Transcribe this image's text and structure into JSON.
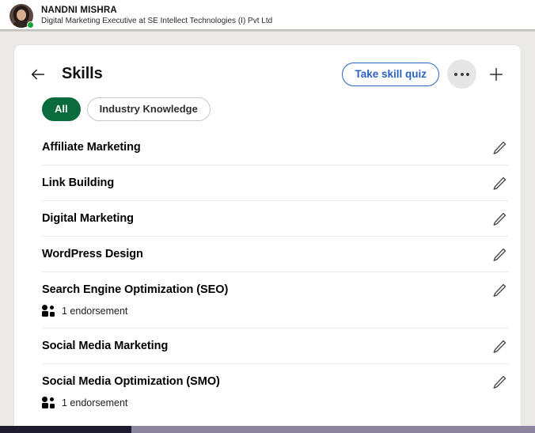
{
  "profile": {
    "name": "NANDNI MISHRA",
    "headline": "Digital Marketing Executive at SE Intellect Technologies (I) Pvt Ltd",
    "avatar_icon": "user-avatar",
    "status_icon": "online-status-dot",
    "status_color": "#15a03c"
  },
  "card": {
    "back_icon": "back-arrow-icon",
    "title": "Skills",
    "quiz_button_label": "Take skill quiz",
    "more_icon": "ellipsis-icon",
    "add_icon": "plus-icon",
    "accent_blue": "#2a62c0",
    "accent_green": "#0a6b3d"
  },
  "filters": [
    {
      "label": "All",
      "active": true
    },
    {
      "label": "Industry Knowledge",
      "active": false
    }
  ],
  "skills": [
    {
      "name": "Affiliate Marketing",
      "endorsement": null,
      "edit_icon": "pencil-icon"
    },
    {
      "name": "Link Building",
      "endorsement": null,
      "edit_icon": "pencil-icon"
    },
    {
      "name": "Digital Marketing",
      "endorsement": null,
      "edit_icon": "pencil-icon"
    },
    {
      "name": "WordPress Design",
      "endorsement": null,
      "edit_icon": "pencil-icon"
    },
    {
      "name": "Search Engine Optimization (SEO)",
      "endorsement": "1 endorsement",
      "edit_icon": "pencil-icon"
    },
    {
      "name": "Social Media Marketing",
      "endorsement": null,
      "edit_icon": "pencil-icon"
    },
    {
      "name": "Social Media Optimization (SMO)",
      "endorsement": "1 endorsement",
      "edit_icon": "pencil-icon"
    }
  ],
  "bottom_strip": {
    "fill_percent": 24.5,
    "fill_color": "#1e1b2e",
    "track_color": "#8b85a0"
  }
}
